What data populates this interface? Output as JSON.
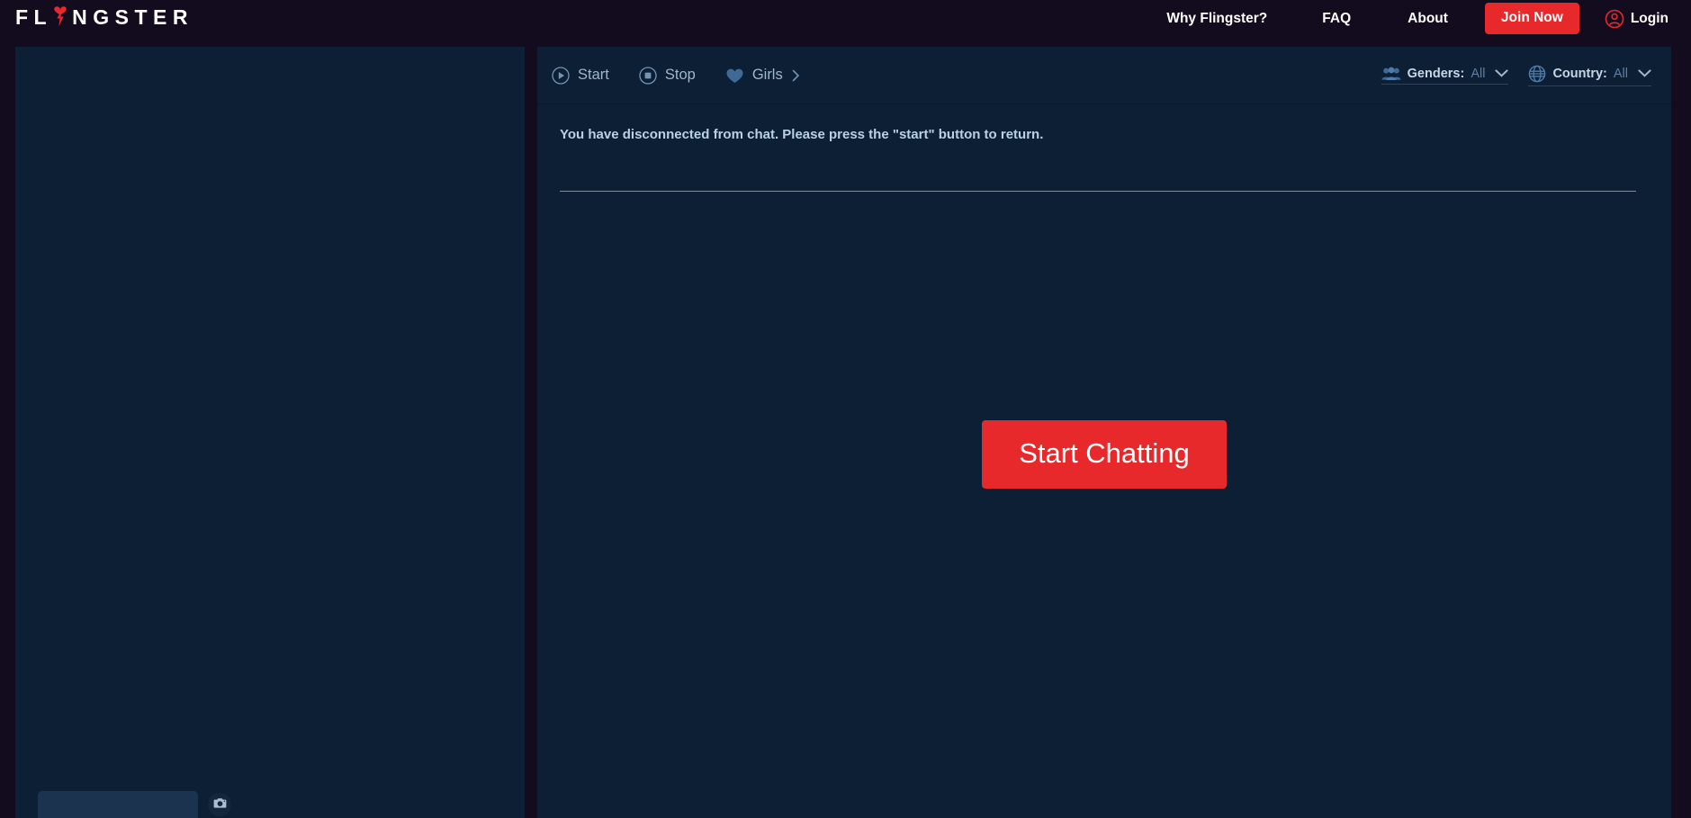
{
  "brand": {
    "name_part1": "FL",
    "name_part2": "NGSTER",
    "logo_icon": "heart-bolt-icon",
    "accent_color": "#E8292C"
  },
  "header": {
    "nav": [
      {
        "label": "Why Flingster?",
        "name": "nav-why-flingster"
      },
      {
        "label": "FAQ",
        "name": "nav-faq"
      },
      {
        "label": "About",
        "name": "nav-about"
      }
    ],
    "join_label": "Join Now",
    "login_label": "Login",
    "login_icon": "user-circle-icon"
  },
  "toolbar": {
    "start_label": "Start",
    "start_icon": "play-circle-icon",
    "stop_label": "Stop",
    "stop_icon": "stop-circle-icon",
    "girls_label": "Girls",
    "girls_icon": "heart-icon",
    "girls_chevron_icon": "chevron-right-icon",
    "genders": {
      "label": "Genders:",
      "value": "All",
      "icon": "people-icon",
      "chevron": "chevron-down-icon"
    },
    "country": {
      "label": "Country:",
      "value": "All",
      "icon": "globe-icon",
      "chevron": "chevron-down-icon"
    }
  },
  "chat": {
    "system_message": "You have disconnected from chat. Please press the \"start\" button to return.",
    "start_chatting_label": "Start Chatting"
  },
  "video": {
    "message_input_value": "",
    "message_input_placeholder": "",
    "camera_icon": "camera-icon"
  }
}
